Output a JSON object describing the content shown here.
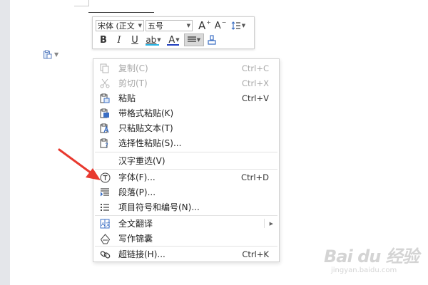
{
  "mini_toolbar": {
    "font_name": "宋体 (正文",
    "font_size": "五号",
    "grow_font": "A",
    "shrink_font": "A",
    "bold": "B",
    "italic": "I",
    "underline": "U",
    "highlight": "ab",
    "font_color_label": "A",
    "font_color": "#1f3fbf",
    "highlight_color": "#2bb7e8"
  },
  "context_menu": {
    "items": [
      {
        "label": "复制(C)",
        "shortcut": "Ctrl+C",
        "icon": "copy-icon",
        "enabled": false
      },
      {
        "label": "剪切(T)",
        "shortcut": "Ctrl+X",
        "icon": "scissors-icon",
        "enabled": false
      },
      {
        "label": "粘贴",
        "shortcut": "Ctrl+V",
        "icon": "paste-icon",
        "enabled": true
      },
      {
        "label": "带格式粘贴(K)",
        "shortcut": "",
        "icon": "paste-format-icon",
        "enabled": true
      },
      {
        "label": "只粘贴文本(T)",
        "shortcut": "",
        "icon": "paste-text-icon",
        "enabled": true
      },
      {
        "label": "选择性粘贴(S)...",
        "shortcut": "",
        "icon": "paste-special-icon",
        "enabled": true
      },
      {
        "label": "汉字重选(V)",
        "shortcut": "",
        "icon": "",
        "enabled": true
      },
      {
        "label": "字体(F)...",
        "shortcut": "Ctrl+D",
        "icon": "font-icon",
        "enabled": true
      },
      {
        "label": "段落(P)...",
        "shortcut": "",
        "icon": "paragraph-icon",
        "enabled": true
      },
      {
        "label": "项目符号和编号(N)...",
        "shortcut": "",
        "icon": "bullet-list-icon",
        "enabled": true
      },
      {
        "label": "全文翻译",
        "shortcut": "",
        "icon": "translate-icon",
        "enabled": true
      },
      {
        "label": "写作锦囊",
        "shortcut": "",
        "icon": "writing-kit-icon",
        "enabled": true
      },
      {
        "label": "超链接(H)...",
        "shortcut": "Ctrl+K",
        "icon": "link-icon",
        "enabled": true
      }
    ]
  },
  "watermark": {
    "brand": "Bai du 经验",
    "url": "jingyan.baidu.com"
  },
  "colors": {
    "annotation_arrow": "#e8392f",
    "icon_blue": "#3b6fc4"
  }
}
